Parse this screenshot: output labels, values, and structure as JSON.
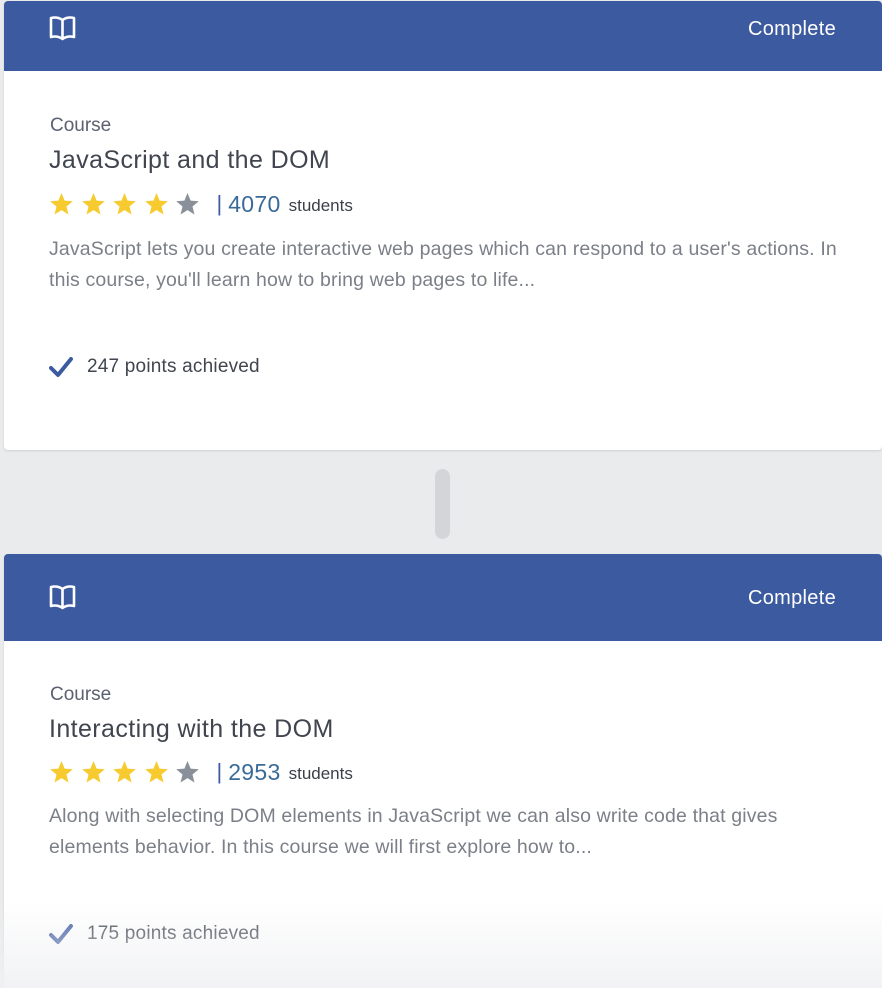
{
  "colors": {
    "header_bg": "#3c5a9f",
    "star_filled": "#f7cb2f",
    "star_empty": "#8a9099",
    "student_count": "#3a6b98",
    "check": "#3c5a9f"
  },
  "courses": [
    {
      "icon": "book-icon",
      "status": "Complete",
      "type": "Course",
      "title": "JavaScript and the DOM",
      "rating": 4,
      "rating_max": 5,
      "separator": "|",
      "students_count": "4070",
      "students_label": "students",
      "description": "JavaScript lets you create interactive web pages which can respond to a user's actions. In this course, you'll learn how to bring web pages to life...",
      "points_icon": "checkmark-icon",
      "points": "247 points achieved"
    },
    {
      "icon": "book-icon",
      "status": "Complete",
      "type": "Course",
      "title": "Interacting with the DOM",
      "rating": 4,
      "rating_max": 5,
      "separator": "|",
      "students_count": "2953",
      "students_label": "students",
      "description": "Along with selecting DOM elements in JavaScript we can also write code that gives elements behavior. In this course we will first explore how to...",
      "points_icon": "checkmark-icon",
      "points": "175 points achieved"
    }
  ]
}
